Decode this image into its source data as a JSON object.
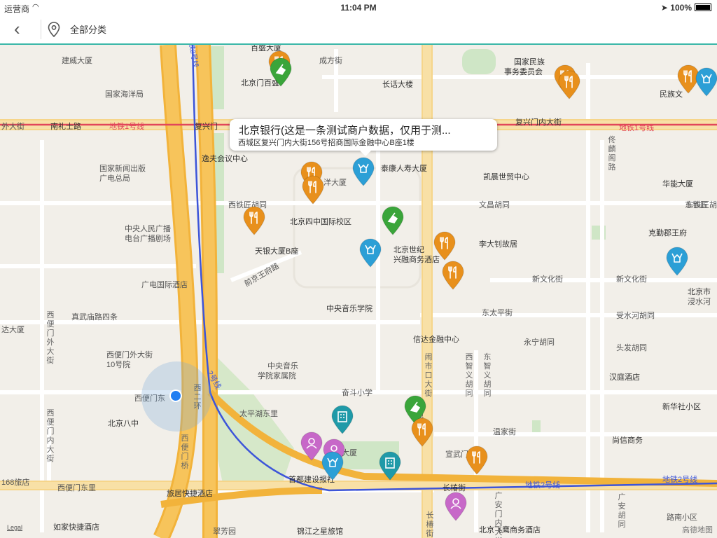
{
  "status": {
    "carrier": "运营商",
    "time": "11:04 PM",
    "battery": "100%"
  },
  "nav": {
    "title": "全部分类",
    "back_icon": "back-chevron-icon",
    "location_icon": "location-pin-icon"
  },
  "callout": {
    "title": "北京银行(这是一条测试商户数据，仅用于测...",
    "address": "西城区复兴门内大街156号招商国际金融中心B座1楼"
  },
  "legal": "Legal",
  "brand": "高德地图",
  "labels": {
    "l1": "建威大厦",
    "l2": "国家海洋局",
    "l3": "南礼士路",
    "l4": "外大街",
    "l5": "复兴门",
    "l6": "地铁1号线",
    "l7": "地铁1号线",
    "l8": "国家新闻出版",
    "l9": "广电总局",
    "l10": "中央人民广播",
    "l11": "电台广播剧场",
    "l12": "广电国际酒店",
    "l13": "真武庙路四条",
    "l14": "达大厦",
    "l15": "西便门外大街",
    "l16": "10号院",
    "l17": "西便门东",
    "l18": "北京八中",
    "l19": "168旅店",
    "l20": "西便门东里",
    "l21": "如家快捷酒店",
    "l22": "旅居快捷酒店",
    "l23": "翠芳园",
    "l24": "锦江之星旅馆",
    "l25": "首都建设报社",
    "l26": "北京飞鹰商务酒店",
    "l27": "长椿街",
    "l28": "地铁2号线",
    "l29": "地铁2号线",
    "l30": "路南小区",
    "l31": "尚信商务",
    "l32": "新华社小区",
    "l33": "汉庭酒店",
    "l34": "头发胡同",
    "l35": "受水河胡同",
    "l36": "北京市",
    "l37": "浸水河",
    "l38": "新文化街",
    "l39": "新文化街",
    "l40": "李大钊故居",
    "l41": "克勤郡王府",
    "l42": "东铁匠",
    "l43": "华能大厦",
    "l44": "文昌胡同",
    "l45": "凯晨世贸中心",
    "l46": "泰康人寿大厦",
    "l47": "洋大厦",
    "l48": "西铁匠胡同",
    "l49": "北京四中国际校区",
    "l50": "天银大厦B座",
    "l51": "北京世纪",
    "l52": "兴融商务酒店",
    "l53": "中央音乐学院",
    "l54": "信达金融中心",
    "l55": "永宁胡同",
    "l56": "东太平街",
    "l57": "中央音乐",
    "l58": "学院家属院",
    "l59": "奋斗小学",
    "l60": "太平湖东里",
    "l61": "大厦",
    "l62": "苑",
    "l63": "宣武门西",
    "l64": "温家街",
    "l65": "逸夫会议中心",
    "l66": "长话大楼",
    "l67": "成方街",
    "l68": "北京门百盛",
    "l69": "百盛大厦",
    "l70": "国家民族",
    "l71": "事务委员会",
    "l72": "复兴门内大街",
    "l73": "民族文",
    "l74": "地铁2号线",
    "l75": "西二环",
    "l76": "广安门内大街",
    "l77": "前京王府路",
    "l78": "西便门外大街",
    "l79": "西便门内大街",
    "l80": "闹市口大街",
    "l81": "西智义胡同",
    "l82": "东智义胡同",
    "l83": "佟麟阁路",
    "l84": "长椿街",
    "l85": "广安胡同",
    "l86": "2号线",
    "l87": "西便门桥",
    "l88": "东铁匠胡同"
  },
  "markers": [
    {
      "type": "restaurant",
      "color": "#e8901c",
      "icon": "fork-knife-icon"
    },
    {
      "type": "attraction",
      "color": "#3aa53a",
      "icon": "leaf-icon"
    },
    {
      "type": "restaurant",
      "color": "#e8901c",
      "icon": "fork-knife-icon"
    },
    {
      "type": "restaurant",
      "color": "#e8901c",
      "icon": "fork-knife-icon"
    },
    {
      "type": "restaurant",
      "color": "#e8901c",
      "icon": "fork-knife-icon"
    },
    {
      "type": "bank",
      "color": "#2c9fd6",
      "icon": "hands-icon"
    },
    {
      "type": "bank",
      "color": "#2c9fd6",
      "icon": "hands-icon"
    },
    {
      "type": "restaurant",
      "color": "#e8901c",
      "icon": "fork-knife-icon"
    },
    {
      "type": "restaurant",
      "color": "#e8901c",
      "icon": "fork-knife-icon"
    },
    {
      "type": "restaurant",
      "color": "#e8901c",
      "icon": "fork-knife-icon"
    },
    {
      "type": "attraction",
      "color": "#3aa53a",
      "icon": "leaf-icon"
    },
    {
      "type": "bank",
      "color": "#2c9fd6",
      "icon": "hands-icon"
    },
    {
      "type": "restaurant",
      "color": "#e8901c",
      "icon": "fork-knife-icon"
    },
    {
      "type": "restaurant",
      "color": "#e8901c",
      "icon": "fork-knife-icon"
    },
    {
      "type": "bank",
      "color": "#2c9fd6",
      "icon": "hands-icon"
    },
    {
      "type": "building",
      "color": "#1f9aa8",
      "icon": "building-icon"
    },
    {
      "type": "building",
      "color": "#1f9aa8",
      "icon": "building-icon"
    },
    {
      "type": "attraction",
      "color": "#3aa53a",
      "icon": "leaf-icon"
    },
    {
      "type": "restaurant",
      "color": "#e8901c",
      "icon": "fork-knife-icon"
    },
    {
      "type": "person",
      "color": "#c768c8",
      "icon": "person-icon"
    },
    {
      "type": "person",
      "color": "#c768c8",
      "icon": "person-icon"
    },
    {
      "type": "bank",
      "color": "#2c9fd6",
      "icon": "hands-icon"
    },
    {
      "type": "restaurant",
      "color": "#e8901c",
      "icon": "fork-knife-icon"
    },
    {
      "type": "person",
      "color": "#c768c8",
      "icon": "person-icon"
    }
  ]
}
